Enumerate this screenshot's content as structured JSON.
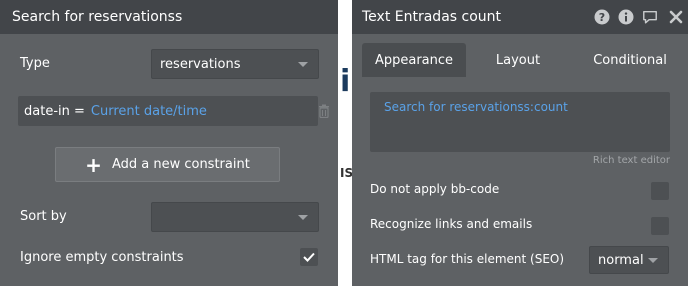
{
  "left_panel": {
    "title": "Search for reservationss",
    "type_label": "Type",
    "type_value": "reservations",
    "constraint": {
      "field": "date-in =",
      "value": "Current date/time"
    },
    "add_constraint_label": "Add a new constraint",
    "sort_by_label": "Sort by",
    "sort_by_value": "",
    "ignore_empty_label": "Ignore empty constraints",
    "ignore_empty_checked": true
  },
  "canvas_fragments": {
    "glyph": "i",
    "text": "ISS"
  },
  "right_panel": {
    "title": "Text Entradas count",
    "header_icons": [
      "help-icon",
      "info-icon",
      "comment-icon",
      "close-icon"
    ],
    "tabs": [
      {
        "label": "Appearance",
        "active": true
      },
      {
        "label": "Layout",
        "active": false
      },
      {
        "label": "Conditional",
        "active": false
      }
    ],
    "rich_text_content": "Search for reservationss:count",
    "rich_text_label": "Rich text editor",
    "properties": {
      "no_bbcode_label": "Do not apply bb-code",
      "recognize_links_label": "Recognize links and emails",
      "html_tag_label": "HTML tag for this element (SEO)",
      "html_tag_value": "normal"
    }
  },
  "colors": {
    "panel_bg": "#5e6164",
    "header_bg": "#424549",
    "field_bg": "#4d5053",
    "link_blue": "#5aa2e8",
    "canvas_text": "#1c3b5e"
  }
}
